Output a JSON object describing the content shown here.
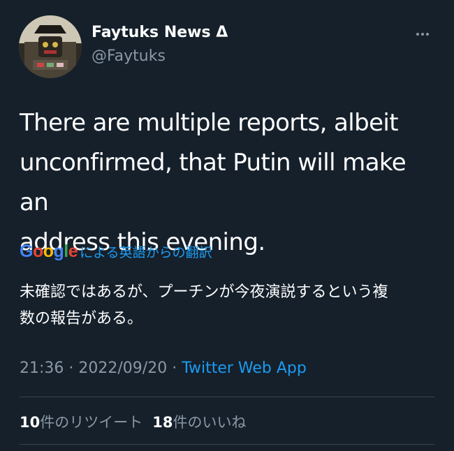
{
  "author": {
    "display_name": "Faytuks News Δ",
    "handle": "@Faytuks",
    "avatar_icon": "profile-avatar"
  },
  "more_icon": "more-horizontal-icon",
  "tweet": {
    "line1": "There are multiple reports, albeit",
    "line2": "unconfirmed, that Putin will make an",
    "line3": "address this evening."
  },
  "translation": {
    "logo": [
      "G",
      "o",
      "o",
      "g",
      "l",
      "e"
    ],
    "label": "による英語からの翻訳",
    "line1": "未確認ではあるが、プーチンが今夜演説するという複",
    "line2": "数の報告がある。"
  },
  "meta": {
    "time": "21:36",
    "sep1": " · ",
    "date": "2022/09/20",
    "sep2": " · ",
    "source": "Twitter Web App"
  },
  "stats": {
    "retweets_count": "10",
    "retweets_label": "件のリツイート",
    "likes_count": "18",
    "likes_label": "件のいいね"
  },
  "colors": {
    "background": "#15202b",
    "text": "#ffffff",
    "secondary": "#8b98a5",
    "link": "#1d9bf0",
    "divider": "#38444d"
  }
}
